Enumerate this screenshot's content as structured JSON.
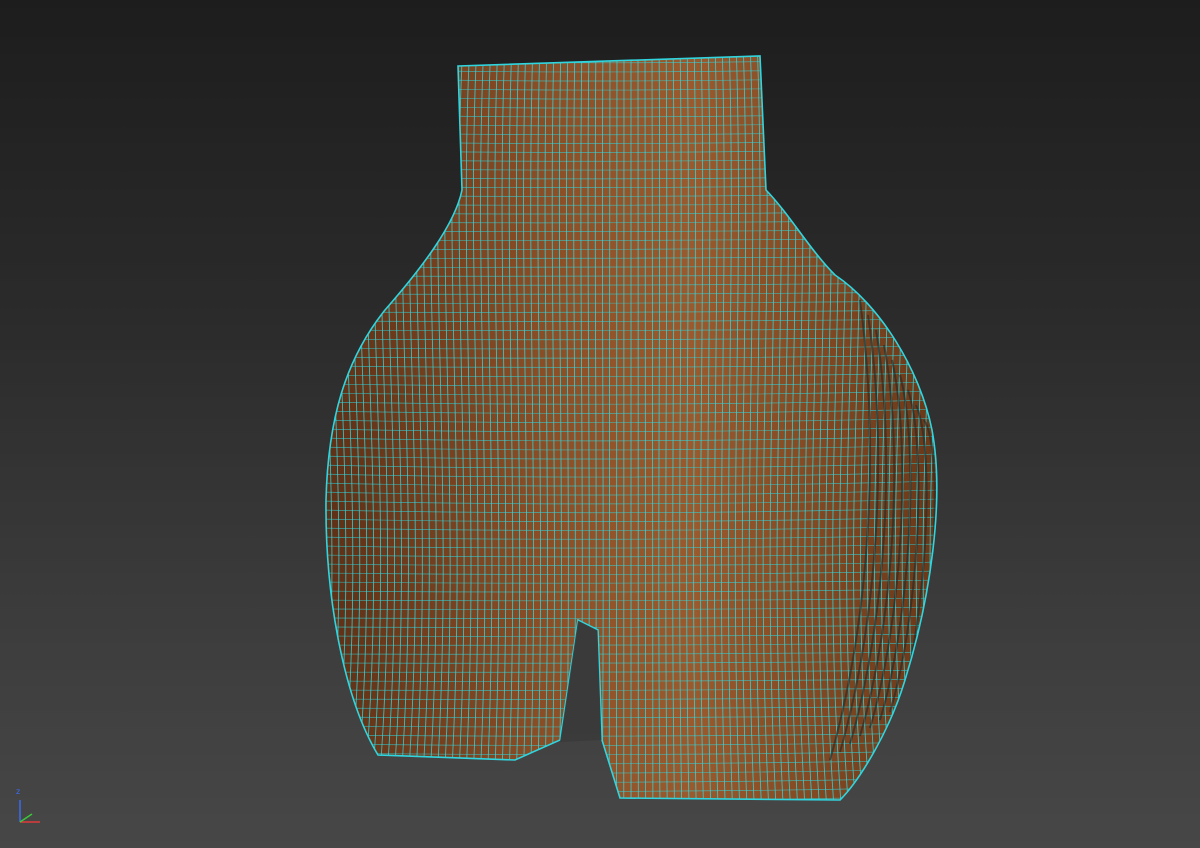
{
  "viewport": {
    "background_top": "#1d1d1d",
    "background_bottom": "#474747",
    "model": {
      "description_icon": "sliced-wood-sculpture",
      "wood_color_light": "#9a5a2d",
      "wood_color_dark": "#5e3016",
      "wire_color": "#2fd6e0"
    },
    "axis_gizmo": {
      "z_label": "z",
      "z_color": "#3a6df0",
      "x_color": "#e03a3a",
      "y_color": "#3ac93a"
    }
  }
}
